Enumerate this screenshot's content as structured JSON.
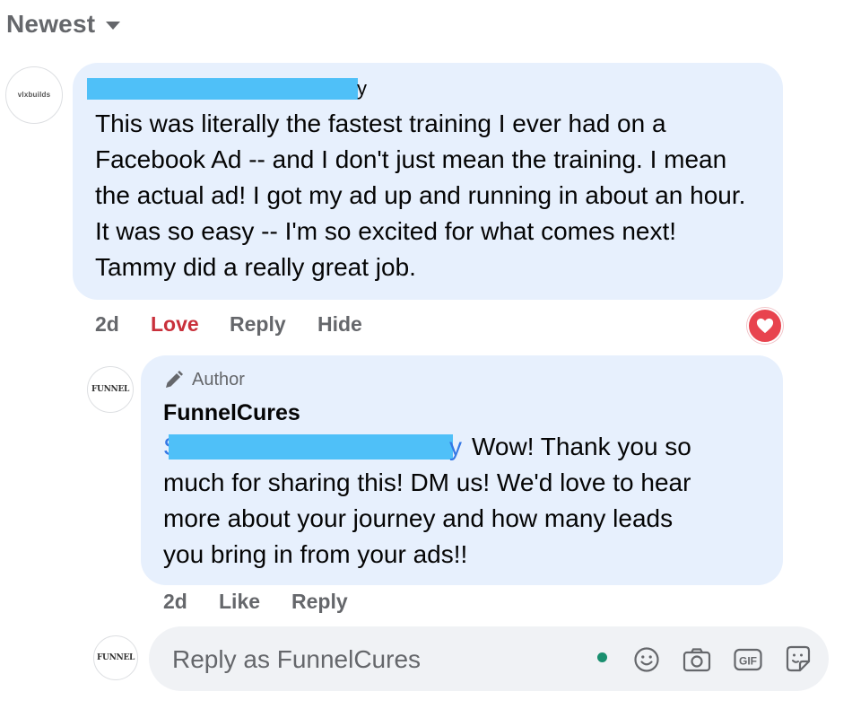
{
  "sort": {
    "label": "Newest"
  },
  "comment": {
    "avatar_text": "vlxbuilds",
    "name_tail": "y",
    "text": "This was literally the fastest training I ever had on a Facebook Ad -- and I don't just mean the training. I mean the actual ad! I got my ad up and running in about an hour. It was so easy -- I'm so excited for what comes next! Tammy did a really great job.",
    "actions": {
      "time": "2d",
      "love": "Love",
      "reply": "Reply",
      "hide": "Hide"
    }
  },
  "reply": {
    "avatar_text": "FUNNEL",
    "author_badge": "Author",
    "name": "FunnelCures",
    "mention_start": "S",
    "mention_end": "y",
    "line1": "Wow! Thank you so",
    "line2": "much for sharing this! DM us! We'd love to hear",
    "line3": "more about your journey and how many leads",
    "line4": "you bring in from your ads!!",
    "actions": {
      "time": "2d",
      "like": "Like",
      "reply": "Reply"
    }
  },
  "composer": {
    "avatar_text": "FUNNEL",
    "placeholder": "Reply as FunnelCures",
    "gif_label": "GIF"
  },
  "colors": {
    "bubble": "#e7f0fd",
    "redaction": "#4fc0f8",
    "love": "#c9303b",
    "mention": "#3578e5",
    "muted": "#65676b"
  },
  "icons": [
    "chevron-down-icon",
    "pencil-icon",
    "heart-icon",
    "emoji-icon",
    "camera-icon",
    "gif-icon",
    "sticker-icon"
  ]
}
